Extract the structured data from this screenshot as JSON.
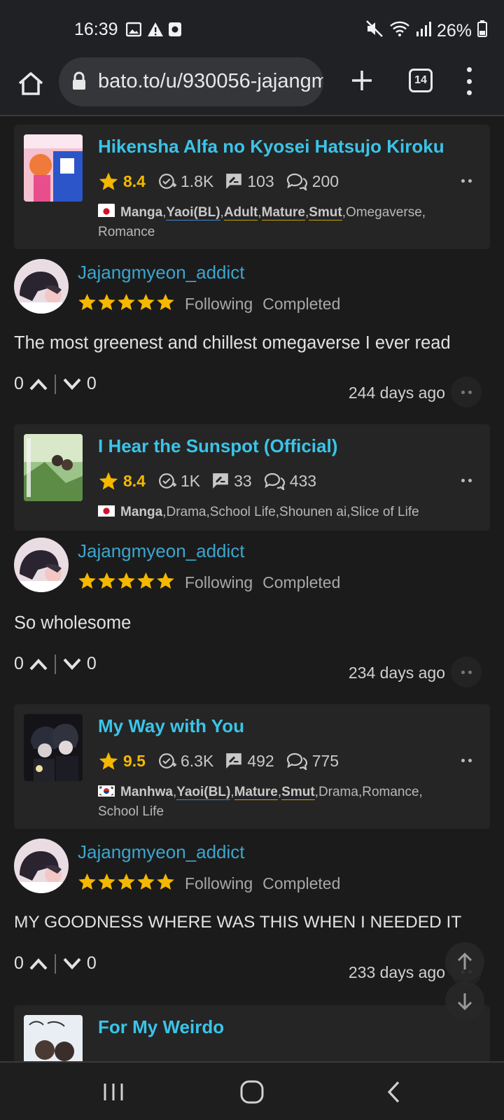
{
  "status_bar": {
    "time": "16:39",
    "battery": "26%"
  },
  "browser": {
    "url": "bato.to/u/930056-jajangmyeon_addict",
    "tab_count": "14"
  },
  "entries": [
    {
      "title": "Hikensha Alfa no Kyosei Hatsujo Kiroku",
      "score": "8.4",
      "follows": "1.8K",
      "reviews": "103",
      "comments": "200",
      "origin": "Manga",
      "tags_bold": [
        "Yaoi(BL)",
        "Adult",
        "Mature",
        "Smut"
      ],
      "tags_rest": "Omegaverse, Romance",
      "user": "Jajangmyeon_addict",
      "status1": "Following",
      "status2": "Completed",
      "comment": "The most greenest and chillest omegaverse I ever read",
      "up": "0",
      "down": "0",
      "ago": "244 days ago"
    },
    {
      "title": "I Hear the Sunspot (Official)",
      "score": "8.4",
      "follows": "1K",
      "reviews": "33",
      "comments": "433",
      "origin": "Manga",
      "tags_rest": "Drama,School Life,Shounen ai,Slice of Life",
      "user": "Jajangmyeon_addict",
      "status1": "Following",
      "status2": "Completed",
      "comment": "So wholesome",
      "up": "0",
      "down": "0",
      "ago": "234 days ago"
    },
    {
      "title": "My Way with You",
      "score": "9.5",
      "follows": "6.3K",
      "reviews": "492",
      "comments": "775",
      "origin": "Manhwa",
      "tags_bold": [
        "Yaoi(BL)",
        "Mature",
        "Smut"
      ],
      "tags_rest": "Drama,Romance, School Life",
      "user": "Jajangmyeon_addict",
      "status1": "Following",
      "status2": "Completed",
      "comment": "MY GOODNESS WHERE WAS THIS WHEN I NEEDED IT",
      "up": "0",
      "down": "0",
      "ago": "233 days ago"
    },
    {
      "title": "For My Weirdo"
    }
  ],
  "colors": {
    "title": "#3bc4e8",
    "username": "#3ba6cf",
    "star": "#f5b800",
    "background": "#1b1b1b",
    "card": "#252525"
  }
}
